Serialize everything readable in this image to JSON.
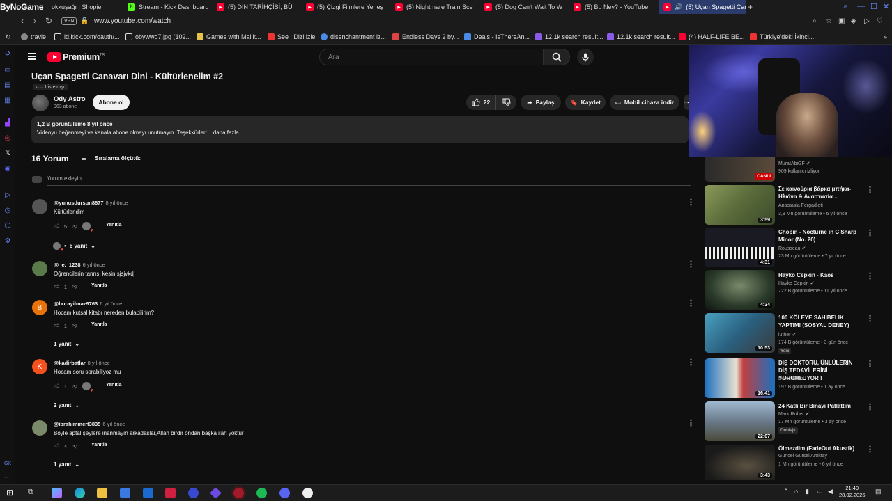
{
  "tabs": [
    {
      "label": "ByNoGame",
      "kind": "brand"
    },
    {
      "label": "okkuşağı | Shopier",
      "kind": "none"
    },
    {
      "label": "Stream - Kick Dashboard",
      "kind": "kick"
    },
    {
      "label": "(5) DİN TARİHÇİSİ, BÜYÜ",
      "kind": "yt"
    },
    {
      "label": "(5) Çizgi Filmlere Yerleşti",
      "kind": "yt"
    },
    {
      "label": "(5) Nightmare Train Scena",
      "kind": "yt"
    },
    {
      "label": "(5) Dog Can't Wait To Wa",
      "kind": "yt"
    },
    {
      "label": "(5) Bu Ney? - YouTube",
      "kind": "yt"
    },
    {
      "label": "(5) Uçan Spagetti Cana",
      "kind": "yt",
      "active": true
    }
  ],
  "address": {
    "url": "www.youtube.com/watch",
    "vpn": "VPN"
  },
  "bookmarks": [
    {
      "label": "travle",
      "color": "#888"
    },
    {
      "label": "id.kick.com/oauth/...",
      "color": "#ddd"
    },
    {
      "label": "obywwo7.jpg (102...",
      "color": "#ddd"
    },
    {
      "label": "Games with Malik...",
      "color": "#e8c34b"
    },
    {
      "label": "See | Dizi izle",
      "color": "#e33"
    },
    {
      "label": "disenchantment iz...",
      "color": "#4b8be8"
    },
    {
      "label": "Endless Days 2 by...",
      "color": "#d44"
    },
    {
      "label": "Deals - IsThereAn...",
      "color": "#4b8be8"
    },
    {
      "label": "12.1k search result...",
      "color": "#8a5be8"
    },
    {
      "label": "12.1k search result...",
      "color": "#8a5be8"
    },
    {
      "label": "(4) HALF-LIFE BE...",
      "color": "#ff0033"
    },
    {
      "label": "Türkiye'deki İkinci...",
      "color": "#e33"
    }
  ],
  "masthead": {
    "logo": "Premium",
    "logo_sup": "TR",
    "search_placeholder": "Ara"
  },
  "video": {
    "title": "Uçan Spagetti Canavarı Dini - Kültürlenelim #2",
    "unlisted": "Liste dışı",
    "channel": "Ody Astro",
    "subscribers": "963 abone",
    "subscribe": "Abone ol",
    "likes": "22",
    "share": "Paylaş",
    "save": "Kaydet",
    "download": "Mobil cihaza indir",
    "desc_line1": "1,2 B görüntüleme  8 yıl önce",
    "desc_line2": "Videoyu beğenmeyi ve kanala abone olmayı unutmayın. Teşekkürler! ...daha fazla"
  },
  "comments_header": {
    "count": "16 Yorum",
    "sort": "Sıralama ölçütü:",
    "add": "Yorum ekleyin..."
  },
  "comments": [
    {
      "author": "@yunusdursun8677",
      "time": "8 yıl önce",
      "text": "Kültürlendim",
      "likes": "5",
      "reply": "Yanıtla",
      "hearted": true,
      "replies": "6 yanıt",
      "avatar_color": "#555",
      "initial": ""
    },
    {
      "author": "@_e._1238",
      "time": "6 yıl önce",
      "text": "Oğrencilerin tanrısı kesin sjsjvkdj",
      "likes": "1",
      "reply": "Yanıtla",
      "hearted": false,
      "replies": "",
      "avatar_color": "#5a7a4a",
      "initial": ""
    },
    {
      "author": "@borayilmaz9763",
      "time": "6 yıl önce",
      "text": "Hocam kutsal kitabı nereden bulabilirim?",
      "likes": "1",
      "reply": "Yanıtla",
      "hearted": false,
      "replies": "1 yanıt",
      "avatar_color": "#e8710a",
      "initial": "B"
    },
    {
      "author": "@kadirbatlar",
      "time": "8 yıl önce",
      "text": "Hocam soru sorabiliyoz mu",
      "likes": "1",
      "reply": "Yanıtla",
      "hearted": true,
      "replies": "2 yanıt",
      "avatar_color": "#f4511e",
      "initial": "K"
    },
    {
      "author": "@ibrahimmert3835",
      "time": "6 yıl önce",
      "text": "Böyle aptal şeylere inanmayın arkadaslar,Allah birdir ondan başka ilah yoktur",
      "likes": "4",
      "reply": "Yanıtla",
      "hearted": false,
      "replies": "1 yanıt",
      "avatar_color": "#7a8a6a",
      "initial": ""
    }
  ],
  "recs": [
    {
      "title": "",
      "channel": "MuratAbiGF",
      "meta": "909 kullanıcı izliyor",
      "live": "CANLI",
      "dur": "",
      "thumb": "#3a2a1a",
      "verified": true
    },
    {
      "title": "Σε καινούρια βάρκα μπήκα- Ηλιάνα & Αναστασία ...",
      "channel": "Anastasia Fergadioti",
      "meta": "3,8 Mn görüntüleme • 6 yıl önce",
      "dur": "3:59",
      "thumb": "#6b7a4a",
      "verified": false
    },
    {
      "title": "Chopin - Nocturne in C Sharp Minor (No. 20)",
      "channel": "Rousseau",
      "meta": "23 Mn görüntüleme • 7 yıl önce",
      "dur": "4:31",
      "thumb": "#1a1a22",
      "verified": true
    },
    {
      "title": "Hayko Cepkin - Kaos",
      "channel": "Hayko Cepkin",
      "meta": "722 B görüntüleme • 11 yıl önce",
      "dur": "4:34",
      "thumb": "#2f3a2a",
      "verified": true
    },
    {
      "title": "100 KÖLEYE SAHİBELİK YAPTIM! (SOSYAL DENEY)",
      "channel": "luther",
      "meta": "174 B görüntüleme • 3 gün önce",
      "badge": "Yeni",
      "dur": "10:53",
      "thumb": "#3a6a8a",
      "verified": true
    },
    {
      "title": "DİŞ DOKTORU, ÜNLÜLERİN DİŞ TEDAVİLERİNİ YORUMLUYOR !",
      "channel": "Deniz Ertüz",
      "meta": "197 B görüntüleme • 1 ay önce",
      "dur": "16:41",
      "thumb": "#2a7ac0",
      "verified": false
    },
    {
      "title": "24 Katlı Bir Binayı Patlattım",
      "channel": "Mark Rober",
      "meta": "17 Mn görüntüleme • 3 ay önce",
      "badge": "Dublajlı",
      "dur": "22:07",
      "thumb": "#7a8a9a",
      "verified": true
    },
    {
      "title": "Ölmezdim (FadeOut Akustik)",
      "channel": "Güncel Gürsel Artıktay",
      "meta": "1 Mn görüntüleme • 6 yıl önce",
      "dur": "3:43",
      "thumb": "#2a2a2a",
      "verified": false
    }
  ],
  "taskbar": {
    "time": "21:49",
    "date": "28.02.2026"
  },
  "colors": {
    "yt_red": "#ff0033",
    "bg": "#0f0f0f",
    "pill": "#272727"
  }
}
